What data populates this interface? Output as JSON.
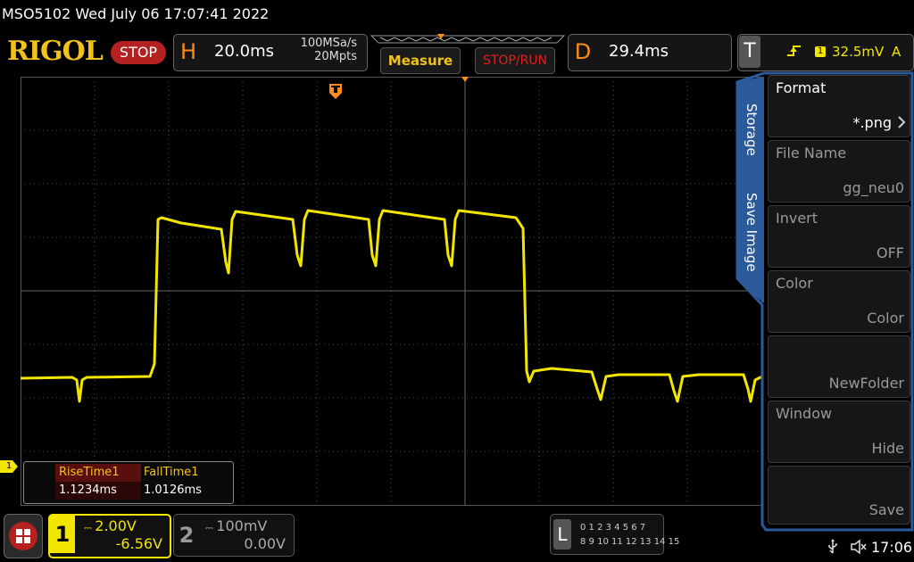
{
  "status_bar": {
    "model_datetime": "MSO5102  Wed July 06 17:07:41 2022"
  },
  "header": {
    "logo": "RIGOL",
    "run_state": "STOP",
    "horizontal": {
      "label": "H",
      "timebase": "20.0ms",
      "sample_rate": "100MSa/s",
      "memory_depth": "20Mpts"
    },
    "measure_label": "Measure",
    "stoprun_label": "STOP/RUN",
    "delay": {
      "label": "D",
      "value": "29.4ms"
    },
    "trigger": {
      "label": "T",
      "edge_icon": "rising-edge-icon",
      "source": "1",
      "level": "32.5mV",
      "mode": "A"
    }
  },
  "waveform": {
    "channel_marker": "1",
    "color": "#f2e500",
    "grid_color": "#555555"
  },
  "measurements": {
    "headers": [
      "RiseTime1",
      "FallTime1"
    ],
    "values": [
      "1.1234ms",
      "1.0126ms"
    ]
  },
  "side_menu": {
    "tabs": [
      "Storage",
      "Save Image"
    ],
    "items": [
      {
        "title": "Format",
        "value": "*.png"
      },
      {
        "title": "File Name",
        "value": "gg_neu0"
      },
      {
        "title": "Invert",
        "value": "OFF"
      },
      {
        "title": "Color",
        "value": "Color"
      },
      {
        "title": "",
        "value": "NewFolder"
      },
      {
        "title": "Window",
        "value": "Hide"
      },
      {
        "title": "",
        "value": "Save"
      }
    ]
  },
  "channels": [
    {
      "number": "1",
      "scale": "2.00V",
      "offset": "-6.56V"
    },
    {
      "number": "2",
      "scale": "100mV",
      "offset": "0.00V"
    }
  ],
  "logic": {
    "label": "L",
    "row1": "0 1 2 3   4 5 6 7",
    "row2": "8 9 10 11 12 13 14 15"
  },
  "footer": {
    "time": "17:06",
    "usb_icon": "usb-icon",
    "speaker_icon": "speaker-muted-icon"
  }
}
